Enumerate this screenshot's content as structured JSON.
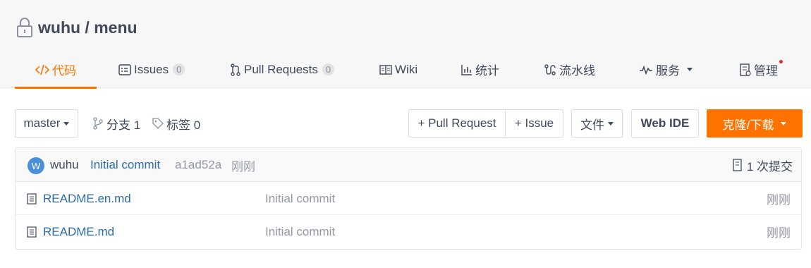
{
  "repo": {
    "title": "wuhu / menu"
  },
  "tabs": [
    {
      "label": "代码",
      "icon": "code-icon",
      "active": true
    },
    {
      "label": "Issues",
      "badge": "0",
      "icon": "issues-icon"
    },
    {
      "label": "Pull Requests",
      "badge": "0",
      "icon": "pull-request-icon"
    },
    {
      "label": "Wiki",
      "icon": "wiki-icon"
    },
    {
      "label": "统计",
      "icon": "stats-icon"
    },
    {
      "label": "流水线",
      "icon": "pipeline-icon"
    },
    {
      "label": "服务",
      "icon": "service-icon"
    },
    {
      "label": "管理",
      "icon": "manage-icon"
    }
  ],
  "toolbar": {
    "branch": "master",
    "branches_label": "分支 1",
    "tags_label": "标签 0",
    "pull_request_btn": "+ Pull Request",
    "issue_btn": "+ Issue",
    "files_btn": "文件",
    "web_ide_btn": "Web IDE",
    "clone_btn": "克隆/下载"
  },
  "commit": {
    "avatar_letter": "W",
    "author": "wuhu",
    "message": "Initial commit",
    "hash": "a1ad52a",
    "time": "刚刚",
    "count_label": "1 次提交"
  },
  "files": [
    {
      "name": "README.en.md",
      "message": "Initial commit",
      "time": "刚刚"
    },
    {
      "name": "README.md",
      "message": "Initial commit",
      "time": "刚刚"
    }
  ],
  "colors": {
    "accent": "#fe7300",
    "link": "#2a6cae",
    "avatar": "#4a90d9"
  }
}
